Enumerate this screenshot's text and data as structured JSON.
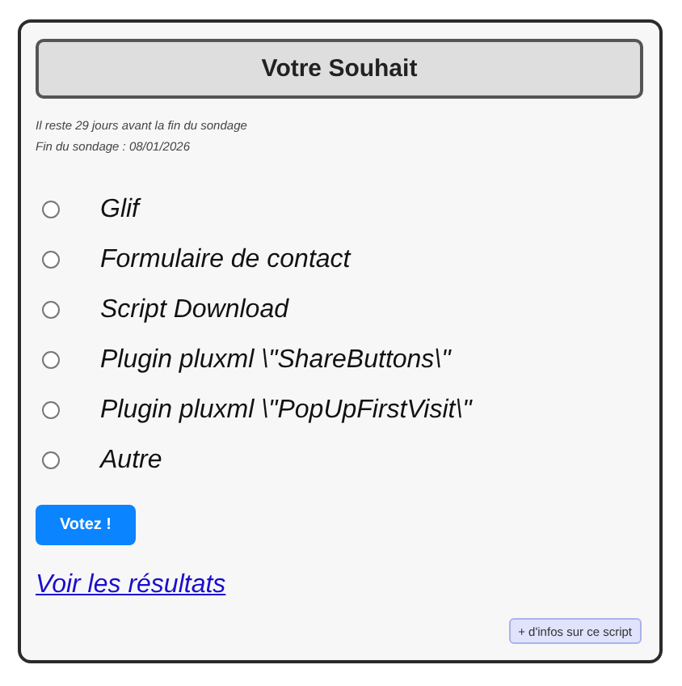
{
  "title": "Votre Souhait",
  "info": [
    "Il reste 29 jours avant la fin du sondage",
    "Fin du sondage : 08/01/2026"
  ],
  "options": [
    {
      "label": "Glif",
      "selected": false
    },
    {
      "label": "Formulaire de contact",
      "selected": false
    },
    {
      "label": "Script Download",
      "selected": false
    },
    {
      "label": "Plugin pluxml \\\"ShareButtons\\\"",
      "selected": false
    },
    {
      "label": "Plugin pluxml \\\"PopUpFirstVisit\\\"",
      "selected": false
    },
    {
      "label": "Autre",
      "selected": false
    }
  ],
  "vote_button": "Votez !",
  "results_link": "Voir les résultats",
  "info_button": "+ d'infos sur ce script"
}
